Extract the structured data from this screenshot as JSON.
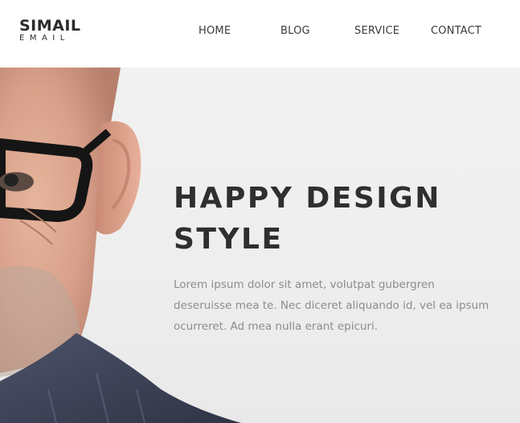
{
  "logo": {
    "name": "SIMAIL",
    "tagline": "EMAIL"
  },
  "nav": [
    {
      "label": "HOME"
    },
    {
      "label": "BLOG"
    },
    {
      "label": "SERVICE"
    },
    {
      "label": "CONTACT"
    }
  ],
  "hero": {
    "title_line1": "HAPPY DESIGN",
    "title_line2": "STYLE",
    "text": "Lorem ipsum dolor sit amet, volutpat gubergren deseruisse mea te. Nec diceret aliquando id, vel ea ipsum ocurreret. Ad mea nulla erant epicuri."
  },
  "colors": {
    "heading": "#2f2f2f",
    "body_text": "#8c8c8c",
    "hero_background": "#eeeeee"
  }
}
